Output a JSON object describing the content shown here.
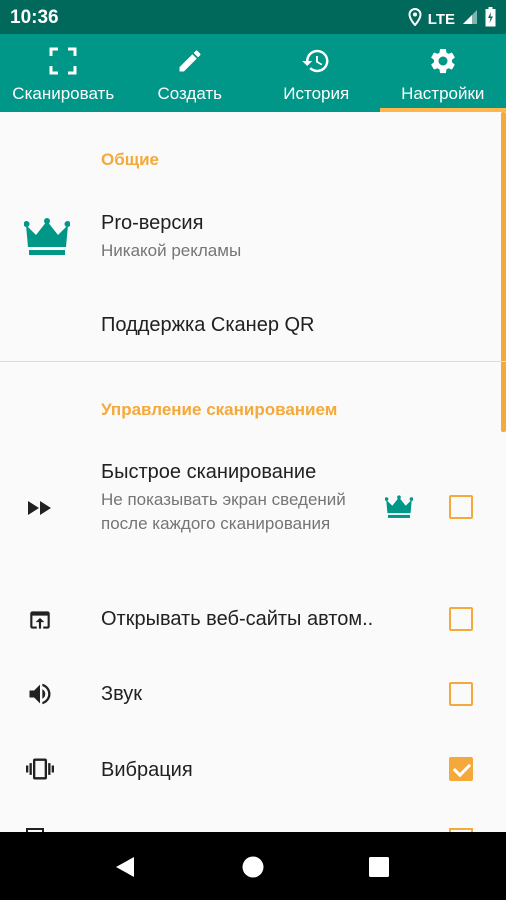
{
  "status_bar": {
    "time": "10:36",
    "network": "LTE",
    "icons": [
      "location-icon",
      "signal-icon",
      "battery-icon"
    ]
  },
  "tabs": [
    {
      "label": "Сканировать",
      "icon": "scan-icon",
      "active": false
    },
    {
      "label": "Создать",
      "icon": "pencil-icon",
      "active": false
    },
    {
      "label": "История",
      "icon": "history-icon",
      "active": false
    },
    {
      "label": "Настройки",
      "icon": "gear-icon",
      "active": true
    }
  ],
  "sections": {
    "general": {
      "header": "Общие",
      "pro": {
        "title": "Pro-версия",
        "subtitle": "Никакой рекламы",
        "icon": "crown-icon"
      },
      "support": {
        "title": "Поддержка Сканер QR"
      }
    },
    "scan_control": {
      "header": "Управление сканированием",
      "items": [
        {
          "title": "Быстрое сканирование",
          "subtitle": "Не показывать экран сведений после каждого сканирования",
          "icon": "fast-forward-icon",
          "pro_badge": "crown-icon",
          "checked": false
        },
        {
          "title": "Открывать веб-сайты автом..",
          "icon": "open-in-browser-icon",
          "checked": false
        },
        {
          "title": "Звук",
          "icon": "volume-icon",
          "checked": false
        },
        {
          "title": "Вибрация",
          "icon": "vibration-icon",
          "checked": true
        }
      ]
    }
  },
  "colors": {
    "primary": "#009688",
    "primary_dark": "#00695c",
    "accent": "#f4a93a",
    "text_primary": "#212121",
    "text_secondary": "#757575"
  },
  "nav": [
    "back-icon",
    "home-icon",
    "recents-icon"
  ]
}
